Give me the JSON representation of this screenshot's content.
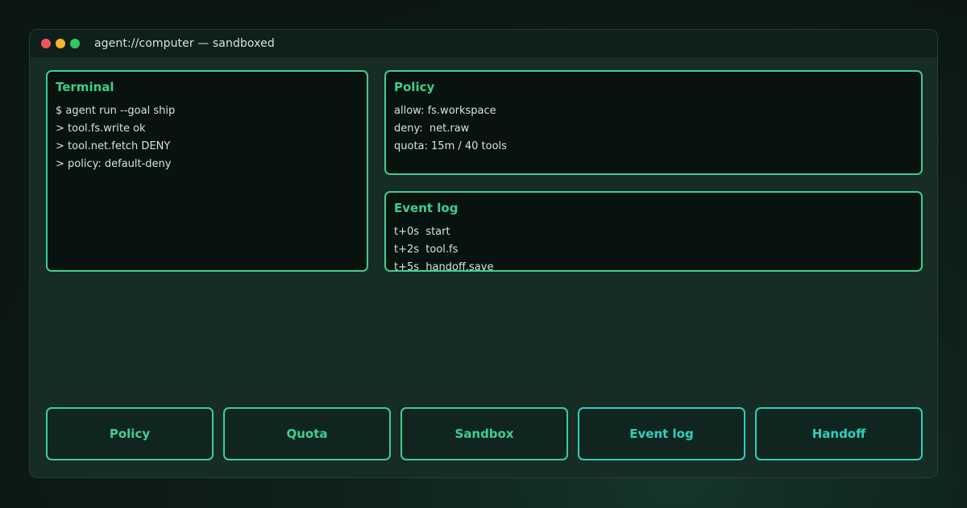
{
  "window": {
    "title": "agent://computer — sandboxed"
  },
  "terminal": {
    "title": "Terminal",
    "lines": [
      "$ agent run --goal ship",
      "> tool.fs.write ok",
      "> tool.net.fetch DENY",
      "> policy: default-deny"
    ]
  },
  "policy": {
    "title": "Policy",
    "lines": [
      "allow: fs.workspace",
      "deny:  net.raw",
      "quota: 15m / 40 tools"
    ]
  },
  "event_log": {
    "title": "Event log",
    "lines": [
      "t+0s  start",
      "t+2s  tool.fs",
      "t+5s  handoff.save"
    ]
  },
  "buttons": [
    {
      "label": "Policy"
    },
    {
      "label": "Quota"
    },
    {
      "label": "Sandbox"
    },
    {
      "label": "Event log"
    },
    {
      "label": "Handoff"
    }
  ],
  "colors": {
    "accent_green": "#3ecf8e",
    "accent_cyan": "#2ed0bd",
    "window_bg": "#162c25",
    "panel_bg": "#08120f"
  }
}
